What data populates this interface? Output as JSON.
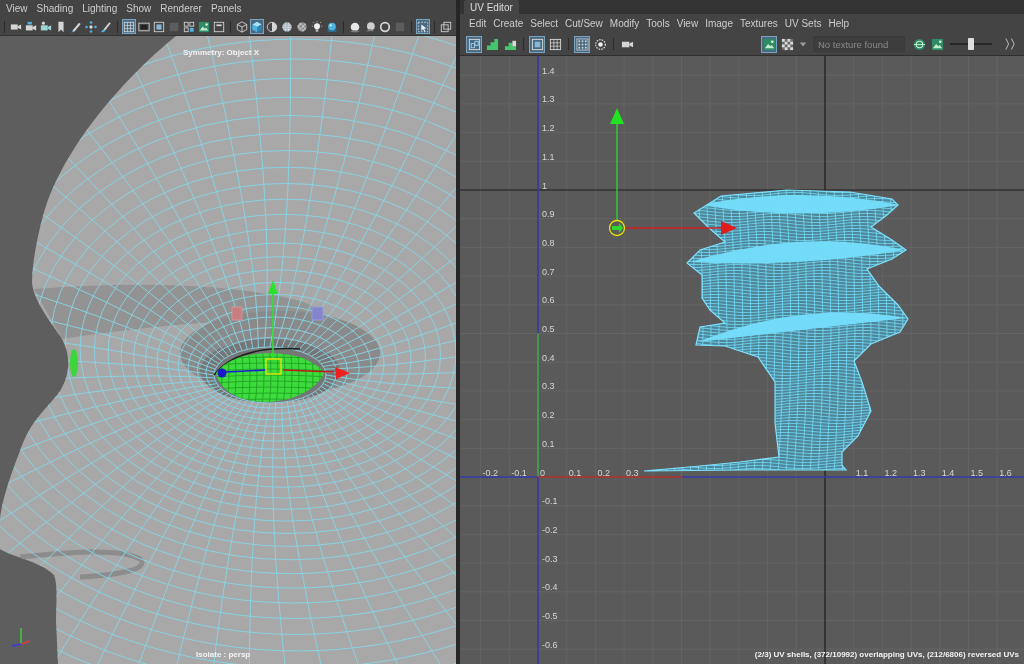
{
  "viewport": {
    "menu": [
      "View",
      "Shading",
      "Lighting",
      "Show",
      "Renderer",
      "Panels"
    ],
    "toolbar": [
      {
        "selected": false
      },
      {
        "selected": false
      },
      {
        "selected": false
      },
      {
        "selected": false
      },
      {
        "selected": false
      },
      {
        "selected": false
      },
      {
        "selected": false
      },
      {
        "selected": true
      },
      {
        "selected": false
      },
      {
        "selected": false
      },
      {
        "selected": false
      },
      {
        "selected": false
      },
      {
        "selected": false
      },
      {
        "selected": false
      },
      {
        "selected": false
      },
      {
        "selected": true
      },
      {
        "selected": false
      },
      {
        "selected": false
      },
      {
        "selected": false
      },
      {
        "selected": false
      },
      {
        "selected": false
      },
      {
        "selected": false
      },
      {
        "selected": false
      },
      {
        "selected": false
      },
      {
        "selected": false
      },
      {
        "selected": true
      },
      {
        "selected": false
      }
    ],
    "symmetry_label": "Symmetry: Object X",
    "camera_label": "Isolate : persp"
  },
  "uv_editor": {
    "tab": "UV Editor",
    "menu": [
      "Edit",
      "Create",
      "Select",
      "Cut/Sew",
      "Modify",
      "Tools",
      "View",
      "Image",
      "Textures",
      "UV Sets",
      "Help"
    ],
    "toolbar": [
      {
        "selected": true
      },
      {
        "selected": false
      },
      {
        "selected": false
      },
      {
        "selected": true
      },
      {
        "selected": false
      },
      {
        "selected": true
      },
      {
        "selected": false
      },
      {
        "selected": false
      }
    ],
    "display_toggles": [
      {
        "selected": true
      },
      {
        "selected": false
      }
    ],
    "texture_field": {
      "placeholder": "No texture found"
    },
    "slider": {
      "level": 0.5
    },
    "v_labels": [
      "1.4",
      "1.3",
      "1.2",
      "1.1",
      "1",
      "0.9",
      "0.8",
      "0.7",
      "0.6",
      "0.5",
      "0.4",
      "0.3",
      "0.2",
      "0.1",
      "-0.1",
      "-0.2",
      "-0.3",
      "-0.4",
      "-0.5",
      "-0.6"
    ],
    "u_labels": [
      "-0.2",
      "-0.1",
      "0",
      "0.1",
      "0.2",
      "0.3",
      "1.1",
      "1.2",
      "1.3",
      "1.4",
      "1.5",
      "1.6"
    ],
    "status": "(2/3) UV shells, (372/10992) overlapping UVs, (212/6806) reversed UVs"
  }
}
